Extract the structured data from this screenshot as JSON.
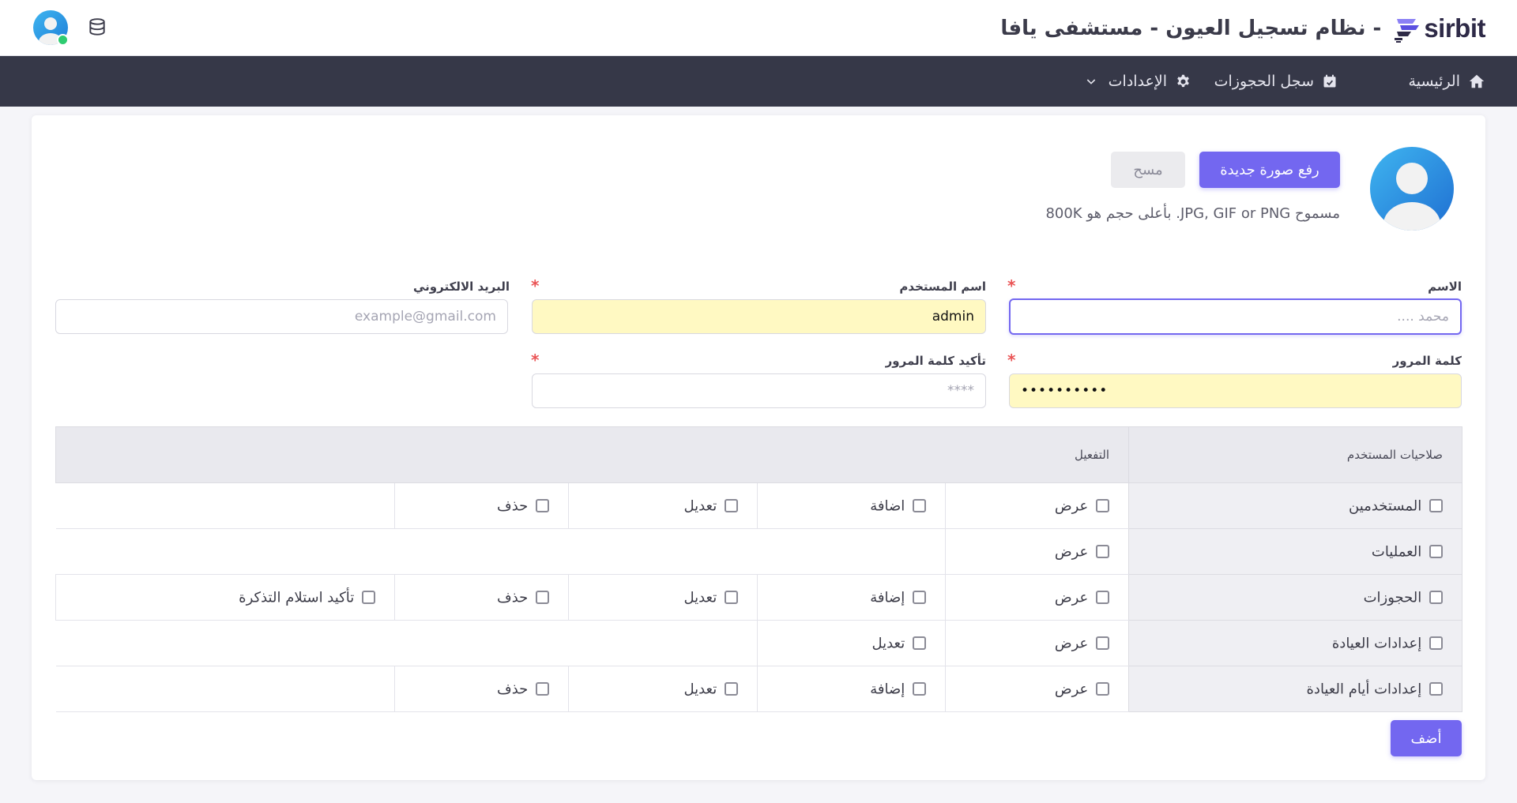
{
  "header": {
    "logo_text": "sirbit",
    "title": "- نظام تسجيل العيون - مستشفى يافا"
  },
  "nav": {
    "home": "الرئيسية",
    "bookings": "سجل الحجوزات",
    "settings": "الإعدادات"
  },
  "profile": {
    "upload_button": "رفع صورة جديدة",
    "reset_button": "مسح",
    "hint": "مسموح JPG, GIF or PNG. بأعلى حجم هو 800K"
  },
  "form": {
    "name": {
      "label": "الاسم",
      "placeholder": "محمد ....",
      "value": ""
    },
    "username": {
      "label": "اسم المستخدم",
      "value": "admin"
    },
    "email": {
      "label": "البريد الالكتروني",
      "placeholder": "example@gmail.com",
      "value": ""
    },
    "password": {
      "label": "كلمة المرور",
      "value": "••••••••••"
    },
    "confirm_password": {
      "label": "تأكيد كلمة المرور",
      "placeholder": "****",
      "value": ""
    },
    "required_mark": "*"
  },
  "permissions": {
    "header_permissions": "صلاحيات المستخدم",
    "header_activation": "التفعيل",
    "rows": [
      {
        "name": "المستخدمين",
        "actions": [
          "عرض",
          "اضافة",
          "تعديل",
          "حذف"
        ]
      },
      {
        "name": "العمليات",
        "actions": [
          "عرض"
        ]
      },
      {
        "name": "الحجوزات",
        "actions": [
          "عرض",
          "إضافة",
          "تعديل",
          "حذف",
          "تأكيد استلام التذكرة"
        ]
      },
      {
        "name": "إعدادات العيادة",
        "actions": [
          "عرض",
          "تعديل"
        ]
      },
      {
        "name": "إعدادات أيام العيادة",
        "actions": [
          "عرض",
          "إضافة",
          "تعديل",
          "حذف"
        ]
      }
    ]
  },
  "actions": {
    "add_button": "أضف"
  },
  "colors": {
    "primary": "#7367f0",
    "navbar": "#363848",
    "autofill": "#fff9c2",
    "required": "#ea5455"
  }
}
